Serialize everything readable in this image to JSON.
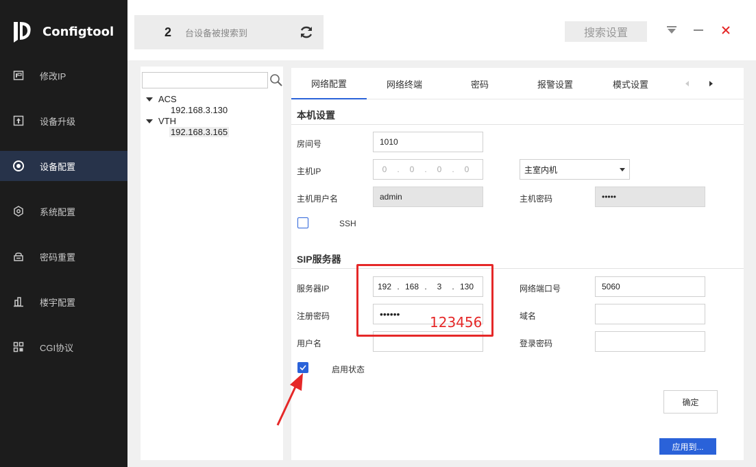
{
  "app": {
    "name": "Configtool"
  },
  "sidebar": {
    "items": [
      {
        "label": "修改IP",
        "icon": "ip-icon"
      },
      {
        "label": "设备升级",
        "icon": "upgrade-icon"
      },
      {
        "label": "设备配置",
        "icon": "config-icon",
        "active": true
      },
      {
        "label": "系统配置",
        "icon": "system-icon"
      },
      {
        "label": "密码重置",
        "icon": "password-reset-icon"
      },
      {
        "label": "楼宇配置",
        "icon": "building-icon"
      },
      {
        "label": "CGI协议",
        "icon": "cgi-icon"
      }
    ]
  },
  "header": {
    "device_count": "2",
    "device_count_text": "台设备被搜索到",
    "search_settings_label": "搜索设置"
  },
  "tree": {
    "search_placeholder": "",
    "groups": [
      {
        "name": "ACS",
        "devices": [
          "192.168.3.130"
        ]
      },
      {
        "name": "VTH",
        "devices": [
          "192.168.3.165"
        ]
      }
    ],
    "selected": "192.168.3.165"
  },
  "tabs": {
    "items": [
      "网络配置",
      "网络终端",
      "密码",
      "报警设置",
      "模式设置"
    ],
    "active": "网络配置"
  },
  "local": {
    "title": "本机设置",
    "room_label": "房间号",
    "room_value": "1010",
    "host_ip_label": "主机IP",
    "host_ip": [
      "0",
      "0",
      "0",
      "0"
    ],
    "host_type_value": "主室内机",
    "host_user_label": "主机用户名",
    "host_user_value": "admin",
    "host_pwd_label": "主机密码",
    "host_pwd_value": "•••••",
    "ssh_label": "SSH",
    "ssh_checked": false
  },
  "sip": {
    "title": "SIP服务器",
    "server_ip_label": "服务器IP",
    "server_ip": [
      "192",
      "168",
      "3",
      "130"
    ],
    "port_label": "网络端口号",
    "port_value": "5060",
    "reg_pwd_label": "注册密码",
    "reg_pwd_value": "••••••",
    "domain_label": "域名",
    "domain_value": "",
    "username_label": "用户名",
    "username_value": "",
    "login_pwd_label": "登录密码",
    "login_pwd_value": "",
    "enable_label": "启用状态",
    "enable_checked": true,
    "ok_label": "确定",
    "apply_label": "应用到..."
  },
  "annotation": {
    "password_hint": "123456",
    "color": "#e52828"
  },
  "colors": {
    "accent": "#2a62d9",
    "sidebar_bg": "#1c1c1c",
    "close": "#e52828"
  }
}
